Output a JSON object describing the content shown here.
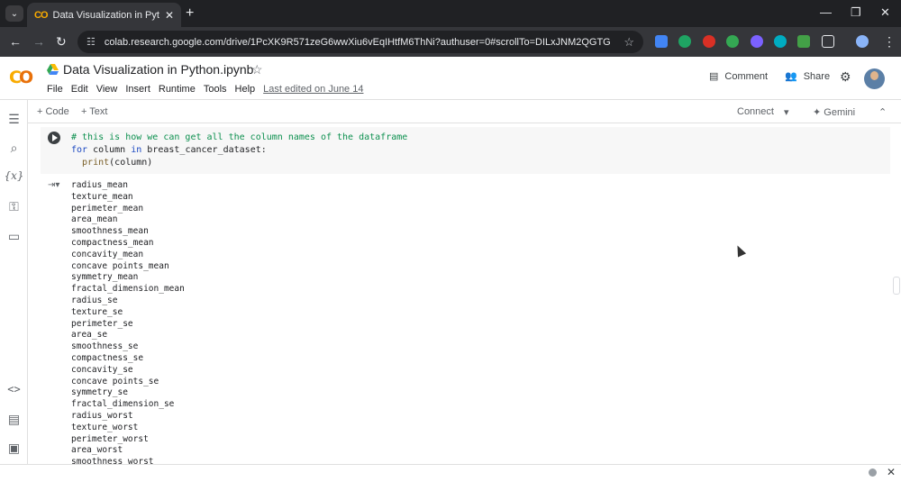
{
  "browser": {
    "tab_title": "Data Visualization in Python.ipy",
    "tab_favicon": "CO",
    "new_tab": "+",
    "url": "colab.research.google.com/drive/1PcXK9R571zeG6wwXiu6vEqIHtfM6ThNi?authuser=0#scrollTo=DILxJNM2QGTG",
    "window_controls": {
      "minimize": "—",
      "restore": "❐",
      "close": "✕"
    }
  },
  "colab": {
    "logo": "CO",
    "notebook_title": "Data Visualization in Python.ipynb",
    "menu": [
      "File",
      "Edit",
      "View",
      "Insert",
      "Runtime",
      "Tools",
      "Help"
    ],
    "last_edited": "Last edited on June 14",
    "comment_label": "Comment",
    "share_label": "Share"
  },
  "toolbar": {
    "add_code": "+ Code",
    "add_text": "+ Text",
    "connect": "Connect",
    "gemini": "Gemini"
  },
  "cell": {
    "line1": "# this is how we can get all the column names of the dataframe",
    "line2_kw": "for",
    "line2_mid": " column ",
    "line2_in": "in",
    "line2_end": " breast_cancer_dataset:",
    "line3_fn": "  print",
    "line3_end": "(column)"
  },
  "output": [
    "radius_mean",
    "texture_mean",
    "perimeter_mean",
    "area_mean",
    "smoothness_mean",
    "compactness_mean",
    "concavity_mean",
    "concave points_mean",
    "symmetry_mean",
    "fractal_dimension_mean",
    "radius_se",
    "texture_se",
    "perimeter_se",
    "area_se",
    "smoothness_se",
    "compactness_se",
    "concavity_se",
    "concave points_se",
    "symmetry_se",
    "fractal_dimension_se",
    "radius_worst",
    "texture_worst",
    "perimeter_worst",
    "area_worst",
    "smoothness_worst"
  ],
  "colors": {
    "accent_orange": "#f9ab00",
    "comment_green": "#0d904f",
    "keyword_blue": "#1a47c1"
  }
}
